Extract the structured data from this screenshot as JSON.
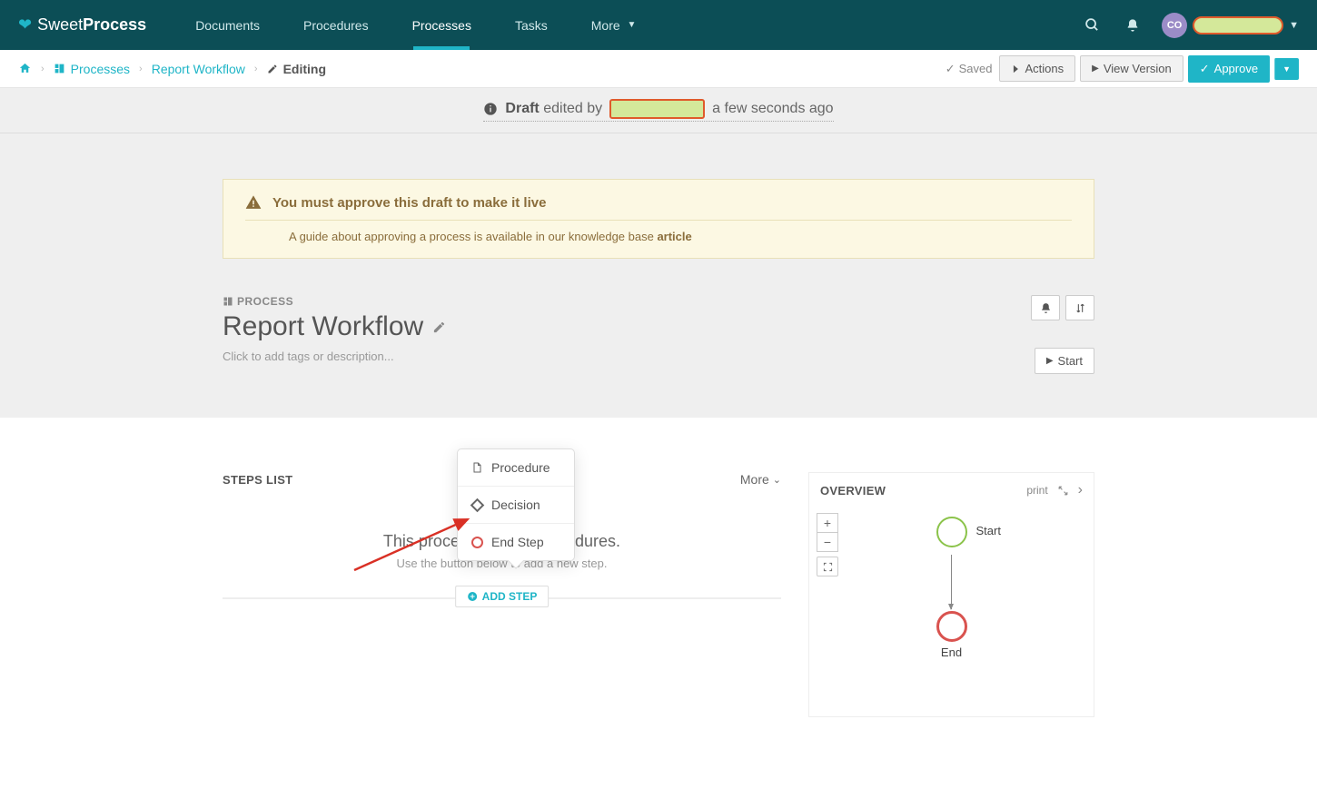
{
  "brand": {
    "name_light": "Sweet",
    "name_bold": "Process"
  },
  "nav": {
    "items": [
      "Documents",
      "Procedures",
      "Processes",
      "Tasks",
      "More"
    ],
    "active_index": 2
  },
  "user": {
    "initials": "CO"
  },
  "breadcrumb": {
    "processes": "Processes",
    "workflow": "Report Workflow",
    "editing": "Editing"
  },
  "toolbar": {
    "saved": "Saved",
    "actions": "Actions",
    "view_version": "View Version",
    "approve": "Approve"
  },
  "draft_banner": {
    "label": "Draft",
    "middle": "edited by",
    "time": "a few seconds ago"
  },
  "alert": {
    "title": "You must approve this draft to make it live",
    "body_prefix": "A guide about approving a process is available in our knowledge base ",
    "body_link": "article"
  },
  "process": {
    "label": "PROCESS",
    "title": "Report Workflow",
    "desc_placeholder": "Click to add tags or description...",
    "start": "Start"
  },
  "steps": {
    "heading": "STEPS LIST",
    "more": "More",
    "empty_title": "This process has no procedures.",
    "empty_sub": "Use the button below to add a new step.",
    "add_step": "ADD STEP",
    "popover": {
      "procedure": "Procedure",
      "decision": "Decision",
      "end_step": "End Step"
    }
  },
  "overview": {
    "heading": "OVERVIEW",
    "print": "print",
    "start_label": "Start",
    "end_label": "End"
  }
}
